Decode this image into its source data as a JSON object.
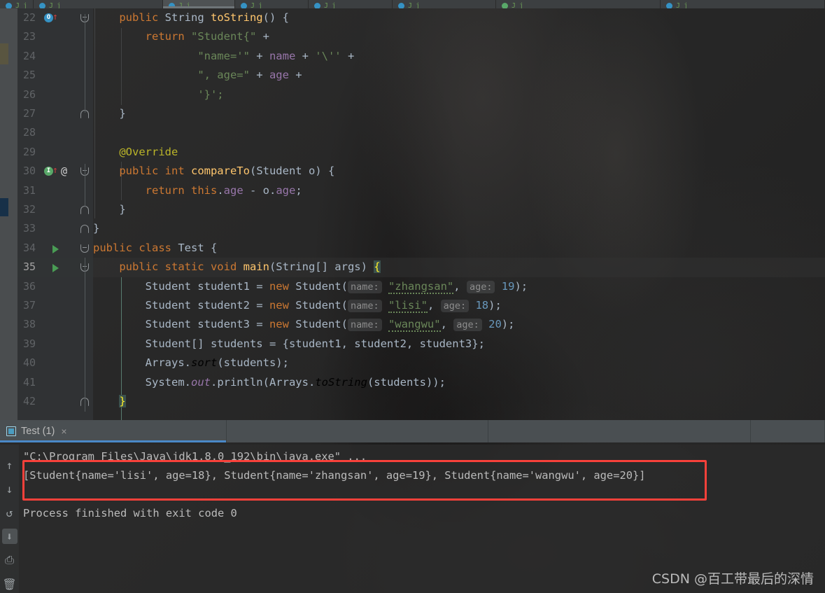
{
  "window": {
    "theme": "darcula",
    "accent_blue": "#4a88c7",
    "annotation_red": "#f8413a"
  },
  "editor_tabs": [
    {
      "icon": "java-class-icon",
      "state": "inactive"
    },
    {
      "icon": "java-class-icon",
      "state": "inactive"
    },
    {
      "icon": "java-class-icon",
      "state": "active"
    },
    {
      "icon": "java-class-icon",
      "state": "inactive"
    },
    {
      "icon": "java-class-icon",
      "state": "inactive"
    },
    {
      "icon": "java-class-icon",
      "state": "inactive"
    },
    {
      "icon": "java-test-icon",
      "state": "inactive"
    },
    {
      "icon": "java-class-icon",
      "state": "inactive"
    }
  ],
  "editor": {
    "first_visible_line": 22,
    "caret_line": 35,
    "lines": [
      {
        "no": "22",
        "gutter": [
          "override-marker",
          "up-arrow"
        ],
        "fold": "open",
        "indent": 1,
        "tokens": [
          {
            "t": "    ",
            "c": "ident"
          },
          {
            "t": "public ",
            "c": "kw"
          },
          {
            "t": "String ",
            "c": "cls"
          },
          {
            "t": "toString",
            "c": "meth"
          },
          {
            "t": "() {",
            "c": "ident"
          }
        ]
      },
      {
        "no": "23",
        "gutter": [],
        "fold": "",
        "indent": 2,
        "tokens": [
          {
            "t": "        ",
            "c": "ident"
          },
          {
            "t": "return ",
            "c": "kw"
          },
          {
            "t": "\"Student{\"",
            "c": "str"
          },
          {
            "t": " + ",
            "c": "ident"
          }
        ]
      },
      {
        "no": "24",
        "gutter": [],
        "fold": "",
        "indent": 2,
        "tokens": [
          {
            "t": "                ",
            "c": "ident"
          },
          {
            "t": "\"name='\"",
            "c": "str"
          },
          {
            "t": " + ",
            "c": "ident"
          },
          {
            "t": "name",
            "c": "fld"
          },
          {
            "t": " + ",
            "c": "ident"
          },
          {
            "t": "'\\''",
            "c": "str"
          },
          {
            "t": " +",
            "c": "ident"
          }
        ]
      },
      {
        "no": "25",
        "gutter": [],
        "fold": "",
        "indent": 2,
        "tokens": [
          {
            "t": "                ",
            "c": "ident"
          },
          {
            "t": "\", age=\"",
            "c": "str"
          },
          {
            "t": " + ",
            "c": "ident"
          },
          {
            "t": "age",
            "c": "fld"
          },
          {
            "t": " +",
            "c": "ident"
          }
        ]
      },
      {
        "no": "26",
        "gutter": [],
        "fold": "",
        "indent": 2,
        "tokens": [
          {
            "t": "                ",
            "c": "ident"
          },
          {
            "t": "'}';",
            "c": "str"
          }
        ]
      },
      {
        "no": "27",
        "gutter": [],
        "fold": "close",
        "indent": 1,
        "tokens": [
          {
            "t": "    }",
            "c": "ident"
          }
        ]
      },
      {
        "no": "28",
        "gutter": [],
        "fold": "",
        "indent": 1,
        "tokens": []
      },
      {
        "no": "29",
        "gutter": [],
        "fold": "",
        "indent": 1,
        "tokens": [
          {
            "t": "    ",
            "c": "ident"
          },
          {
            "t": "@Override",
            "c": "ann"
          }
        ]
      },
      {
        "no": "30",
        "gutter": [
          "implement-marker",
          "up-arrow",
          "at-marker"
        ],
        "fold": "open",
        "indent": 1,
        "tokens": [
          {
            "t": "    ",
            "c": "ident"
          },
          {
            "t": "public ",
            "c": "kw"
          },
          {
            "t": "int ",
            "c": "kw"
          },
          {
            "t": "compareTo",
            "c": "meth"
          },
          {
            "t": "(Student o) {",
            "c": "ident"
          }
        ]
      },
      {
        "no": "31",
        "gutter": [],
        "fold": "",
        "indent": 2,
        "tokens": [
          {
            "t": "        ",
            "c": "ident"
          },
          {
            "t": "return ",
            "c": "kw"
          },
          {
            "t": "this",
            "c": "kw"
          },
          {
            "t": ".",
            "c": "ident"
          },
          {
            "t": "age",
            "c": "fld"
          },
          {
            "t": " - o.",
            "c": "ident"
          },
          {
            "t": "age",
            "c": "fld"
          },
          {
            "t": ";",
            "c": "ident"
          }
        ]
      },
      {
        "no": "32",
        "gutter": [],
        "fold": "close",
        "indent": 1,
        "tokens": [
          {
            "t": "    }",
            "c": "ident"
          }
        ]
      },
      {
        "no": "33",
        "gutter": [],
        "fold": "close",
        "indent": 0,
        "tokens": [
          {
            "t": "}",
            "c": "ident"
          }
        ]
      },
      {
        "no": "34",
        "gutter": [
          "run-marker"
        ],
        "fold": "open",
        "indent": 0,
        "tokens": [
          {
            "t": "public class ",
            "c": "kw"
          },
          {
            "t": "Test",
            "c": "ident"
          },
          {
            "t": " {",
            "c": "ident"
          }
        ]
      },
      {
        "no": "35",
        "gutter": [
          "run-marker"
        ],
        "fold": "open",
        "indent": 1,
        "caret": true,
        "tokens": [
          {
            "t": "    ",
            "c": "ident"
          },
          {
            "t": "public static void ",
            "c": "kw"
          },
          {
            "t": "main",
            "c": "meth"
          },
          {
            "t": "(String[] args) ",
            "c": "ident"
          },
          {
            "t": "{",
            "c": "brace-hl"
          }
        ]
      },
      {
        "no": "36",
        "gutter": [],
        "fold": "",
        "indent": 2,
        "tokens": [
          {
            "t": "        Student student1 = ",
            "c": "ident"
          },
          {
            "t": "new ",
            "c": "kw"
          },
          {
            "t": "Student(",
            "c": "ident"
          },
          {
            "t": "name:",
            "c": "hint"
          },
          {
            "t": " ",
            "c": "ident"
          },
          {
            "t": "\"zhangsan\"",
            "c": "str typo"
          },
          {
            "t": ", ",
            "c": "ident"
          },
          {
            "t": "age:",
            "c": "hint"
          },
          {
            "t": " ",
            "c": "ident"
          },
          {
            "t": "19",
            "c": "num"
          },
          {
            "t": ");",
            "c": "ident"
          }
        ]
      },
      {
        "no": "37",
        "gutter": [],
        "fold": "",
        "indent": 2,
        "tokens": [
          {
            "t": "        Student student2 = ",
            "c": "ident"
          },
          {
            "t": "new ",
            "c": "kw"
          },
          {
            "t": "Student(",
            "c": "ident"
          },
          {
            "t": "name:",
            "c": "hint"
          },
          {
            "t": " ",
            "c": "ident"
          },
          {
            "t": "\"lisi\"",
            "c": "str typo"
          },
          {
            "t": ", ",
            "c": "ident"
          },
          {
            "t": "age:",
            "c": "hint"
          },
          {
            "t": " ",
            "c": "ident"
          },
          {
            "t": "18",
            "c": "num"
          },
          {
            "t": ");",
            "c": "ident"
          }
        ]
      },
      {
        "no": "38",
        "gutter": [],
        "fold": "",
        "indent": 2,
        "tokens": [
          {
            "t": "        Student student3 = ",
            "c": "ident"
          },
          {
            "t": "new ",
            "c": "kw"
          },
          {
            "t": "Student(",
            "c": "ident"
          },
          {
            "t": "name:",
            "c": "hint"
          },
          {
            "t": " ",
            "c": "ident"
          },
          {
            "t": "\"wangwu\"",
            "c": "str typo"
          },
          {
            "t": ", ",
            "c": "ident"
          },
          {
            "t": "age:",
            "c": "hint"
          },
          {
            "t": " ",
            "c": "ident"
          },
          {
            "t": "20",
            "c": "num"
          },
          {
            "t": ");",
            "c": "ident"
          }
        ]
      },
      {
        "no": "39",
        "gutter": [],
        "fold": "",
        "indent": 2,
        "tokens": [
          {
            "t": "        Student[] students = {student1, student2, student3};",
            "c": "ident"
          }
        ]
      },
      {
        "no": "40",
        "gutter": [],
        "fold": "",
        "indent": 2,
        "tokens": [
          {
            "t": "        Arrays.",
            "c": "ident"
          },
          {
            "t": "sort",
            "c": "ital"
          },
          {
            "t": "(students);",
            "c": "ident"
          }
        ]
      },
      {
        "no": "41",
        "gutter": [],
        "fold": "",
        "indent": 2,
        "tokens": [
          {
            "t": "        System.",
            "c": "ident"
          },
          {
            "t": "out",
            "c": "stat"
          },
          {
            "t": ".println(Arrays.",
            "c": "ident"
          },
          {
            "t": "toString",
            "c": "ital"
          },
          {
            "t": "(students));",
            "c": "ident"
          }
        ]
      },
      {
        "no": "42",
        "gutter": [],
        "fold": "close",
        "indent": 1,
        "tokens": [
          {
            "t": "    ",
            "c": "ident"
          },
          {
            "t": "}",
            "c": "brace-hl"
          }
        ]
      }
    ]
  },
  "run_window": {
    "tabs": [
      {
        "label": "Test (1)",
        "icon": "console-icon",
        "close": "×",
        "selected": true
      }
    ],
    "toolbar_buttons": [
      {
        "name": "up-arrow-icon",
        "glyph": "↑",
        "active": false
      },
      {
        "name": "down-arrow-icon",
        "glyph": "↓",
        "active": false
      },
      {
        "name": "soft-wrap-icon",
        "glyph": "↺",
        "active": false
      },
      {
        "name": "scroll-to-end-icon",
        "glyph": "⬇",
        "active": true
      },
      {
        "name": "print-icon",
        "glyph": "⎙",
        "active": false
      },
      {
        "name": "trash-icon",
        "glyph": "🗑",
        "active": false
      }
    ],
    "console_lines": [
      {
        "text": "\"C:\\Program Files\\Java\\jdk1.8.0_192\\bin\\java.exe\" ...",
        "kind": "command"
      },
      {
        "text": "[Student{name='lisi', age=18}, Student{name='zhangsan', age=19}, Student{name='wangwu', age=20}]",
        "kind": "output"
      },
      {
        "text": "",
        "kind": "blank"
      },
      {
        "text": "Process finished with exit code 0",
        "kind": "output"
      }
    ]
  },
  "annotation": {
    "type": "red-rectangle",
    "target": "console-output-line",
    "color": "#f8413a"
  },
  "watermark": {
    "text": "CSDN @百工带最后的深情"
  }
}
